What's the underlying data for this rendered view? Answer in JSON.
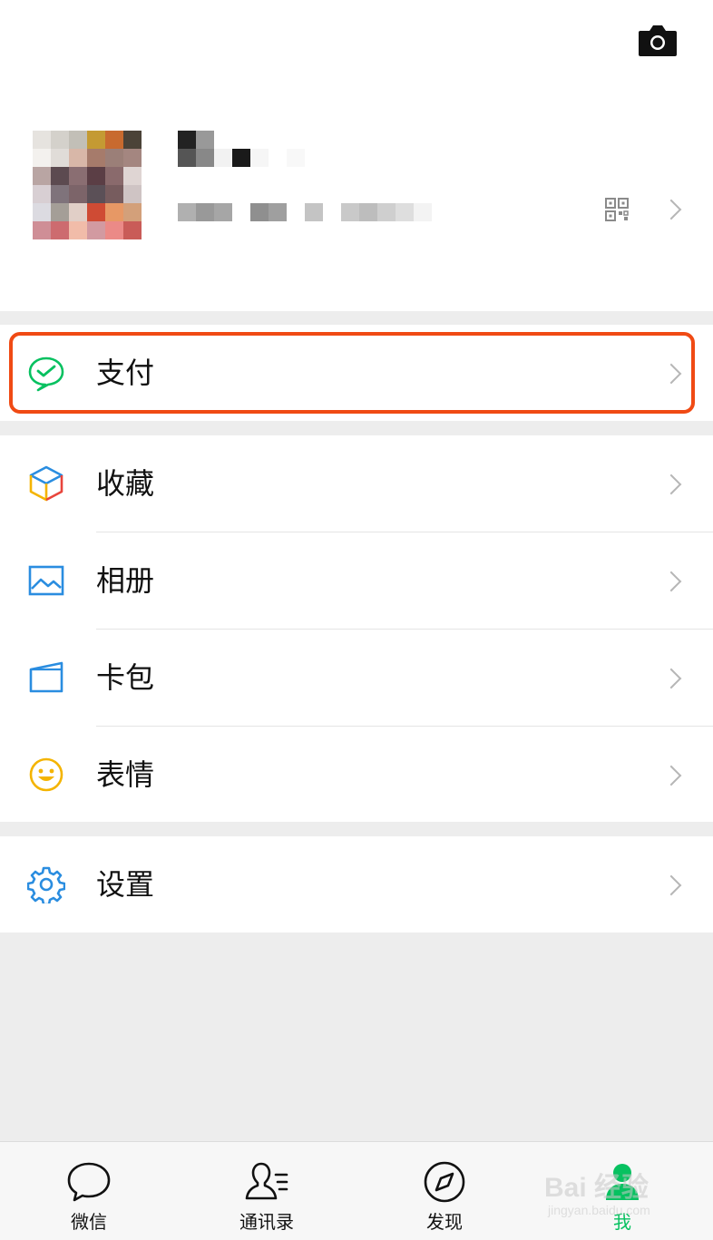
{
  "header": {
    "camera_icon": "camera-icon"
  },
  "profile": {
    "avatar_colors": [
      "#e6e3df",
      "#d4d1cb",
      "#c2bfb7",
      "#c49a33",
      "#c86a2f",
      "#4b4338",
      "#ffffff",
      "#f3f1ee",
      "#e0dcd8",
      "#d8b7a8",
      "#a67b6b",
      "#9b7f78",
      "#a48680",
      "#ffffff",
      "#b9a5a3",
      "#5c4a50",
      "#8a6e72",
      "#5b3e45",
      "#8a6a6c",
      "#dfd5d3",
      "#ffffff",
      "#d8cfd3",
      "#7f737b",
      "#7c6469",
      "#5b5057",
      "#775c5e",
      "#cfc4c4",
      "#ffffff",
      "#dcdbe1",
      "#a49e97",
      "#e1cfc7",
      "#cf4b34",
      "#e79865",
      "#d3a07a",
      "#ffffff",
      "#cf8e96",
      "#cd6b6f",
      "#f1bca9",
      "#d29aa1",
      "#eb8a87",
      "#c95c58",
      "#ffffff"
    ],
    "qr_icon": "qr-code-icon",
    "chevron_icon": "chevron-right-icon"
  },
  "menu": {
    "pay": {
      "label": "支付",
      "icon": "wechat-pay-icon"
    },
    "favorites": {
      "label": "收藏",
      "icon": "cube-icon"
    },
    "album": {
      "label": "相册",
      "icon": "image-icon"
    },
    "cards": {
      "label": "卡包",
      "icon": "card-icon"
    },
    "stickers": {
      "label": "表情",
      "icon": "smile-icon"
    },
    "settings": {
      "label": "设置",
      "icon": "gear-icon"
    }
  },
  "tabbar": {
    "tabs": [
      {
        "label": "微信",
        "icon": "chat-bubble-icon"
      },
      {
        "label": "通讯录",
        "icon": "contacts-icon"
      },
      {
        "label": "发现",
        "icon": "compass-icon"
      },
      {
        "label": "我",
        "icon": "person-icon",
        "active": true
      }
    ]
  },
  "watermark": {
    "line1": "Bai 经验",
    "line2": "jingyan.baidu.com"
  },
  "colors": {
    "highlight": "#f04a14",
    "accent": "#07c160",
    "background": "#ededed"
  }
}
